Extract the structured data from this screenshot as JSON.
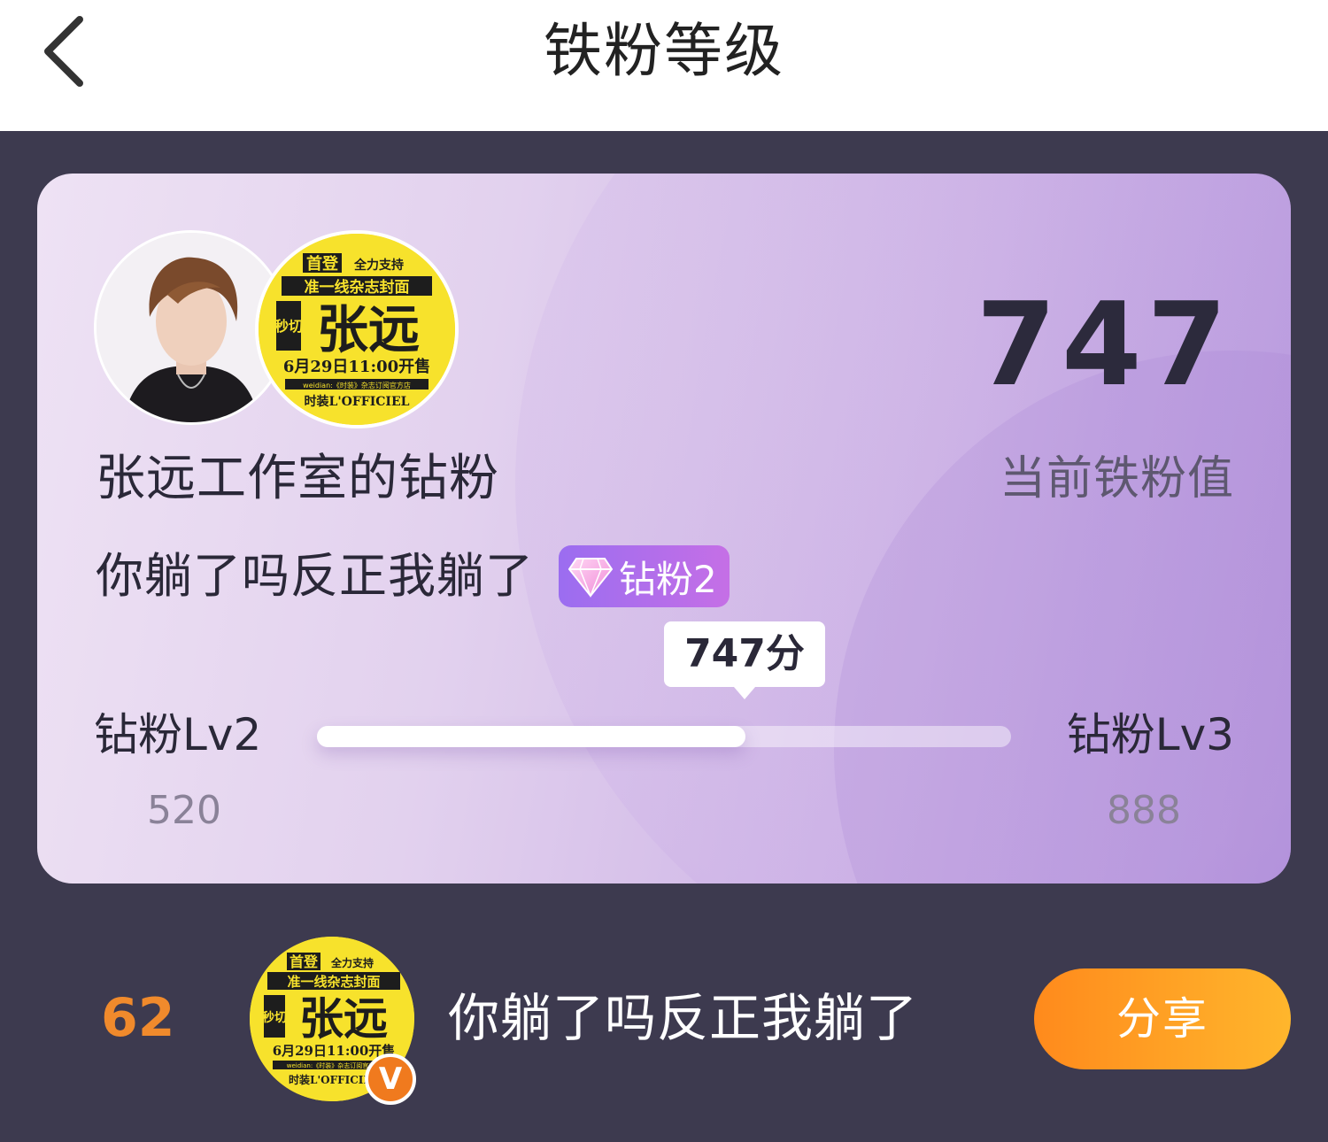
{
  "header": {
    "title": "铁粉等级",
    "back_icon": "chevron-left-icon"
  },
  "card": {
    "fan_group": "张远工作室的钻粉",
    "username": "你躺了吗反正我躺了",
    "badge_label": "钻粉2",
    "badge_icon": "diamond-icon",
    "score": "747",
    "score_label": "当前铁粉值",
    "tooltip": "747分",
    "poster_text": {
      "top": "首登",
      "top_right": "全力支持",
      "line2": "准一线杂志封面",
      "side": "秒切",
      "name": "张远",
      "date": "6月29日11:00开售",
      "small": "weidian:《时装》杂志订阅官方店",
      "brand": "时装L'OFFICIEL"
    },
    "progress": {
      "current_level": "钻粉Lv2",
      "next_level": "钻粉Lv3",
      "current_min": "520",
      "next_min": "888",
      "value": 747,
      "min": 520,
      "max": 888
    }
  },
  "bottom": {
    "rank": "62",
    "name": "你躺了吗反正我躺了",
    "verified_badge": "V",
    "share_label": "分享"
  },
  "colors": {
    "accent_orange": "#f08a2c",
    "badge_purple": "#9b6df0",
    "dark_bg": "#3d3a4f"
  }
}
